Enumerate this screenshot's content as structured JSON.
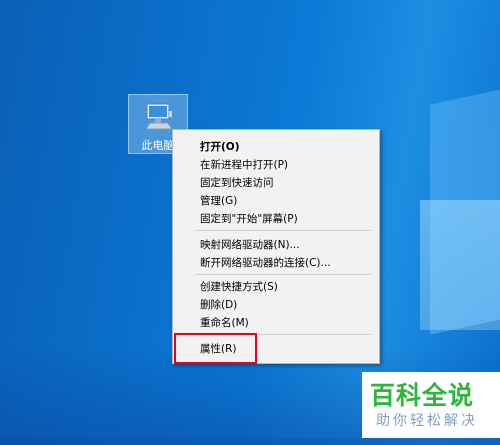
{
  "desktop": {
    "icon_label": "此电脑"
  },
  "context_menu": {
    "items": [
      {
        "label": "打开(O)",
        "default": true
      },
      {
        "label": "在新进程中打开(P)"
      },
      {
        "label": "固定到快速访问"
      },
      {
        "label": "管理(G)"
      },
      {
        "label": "固定到\"开始\"屏幕(P)"
      },
      {
        "label": "映射网络驱动器(N)..."
      },
      {
        "label": "断开网络驱动器的连接(C)..."
      },
      {
        "label": "创建快捷方式(S)"
      },
      {
        "label": "删除(D)"
      },
      {
        "label": "重命名(M)"
      },
      {
        "label": "属性(R)"
      }
    ],
    "highlight_color": "#e8001c"
  },
  "watermark": {
    "title": "百科全说",
    "subtitle": "助你轻松解决"
  },
  "colors": {
    "desktop_blue": "#0b73cf",
    "watermark_green": "#2db53c"
  }
}
